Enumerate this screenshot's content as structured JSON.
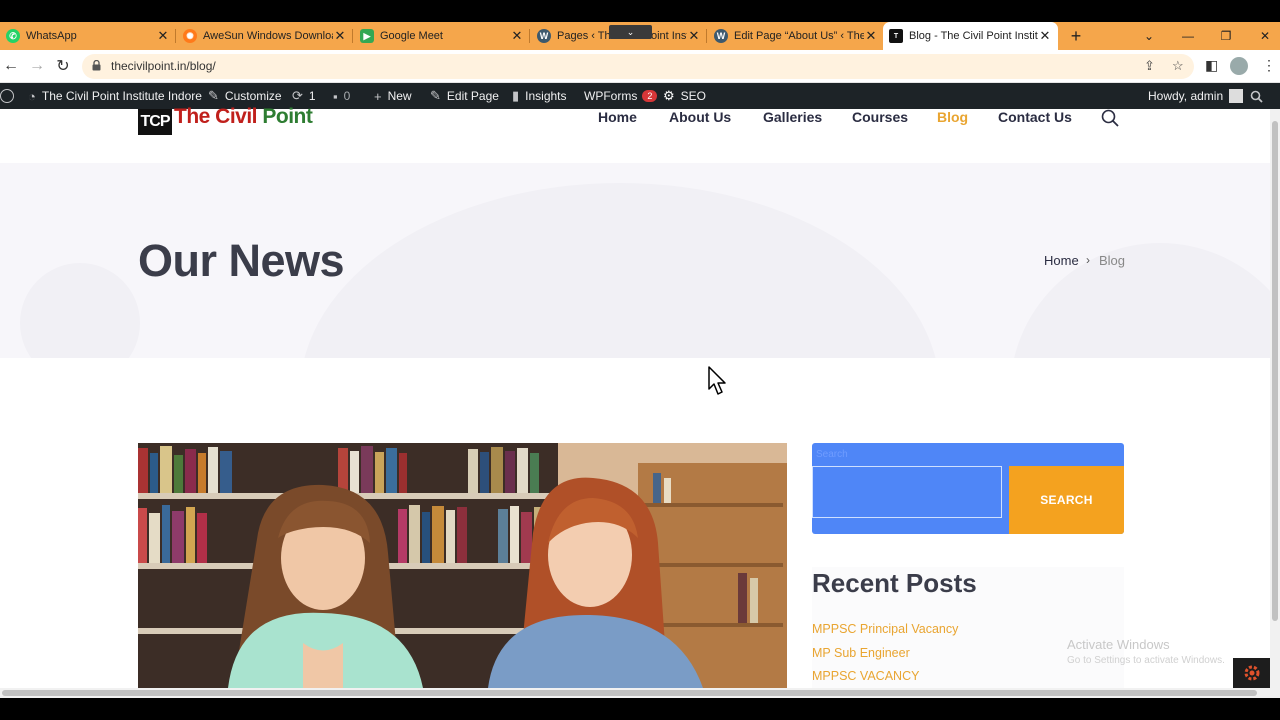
{
  "browser": {
    "tabs": [
      {
        "label": "WhatsApp",
        "icon": "whatsapp-icon"
      },
      {
        "label": "AweSun Windows Downloa",
        "icon": "awesun-icon"
      },
      {
        "label": "Google Meet",
        "icon": "google-meet-icon"
      },
      {
        "label": "Pages ‹ The Civil Point Instit",
        "icon": "wordpress-icon"
      },
      {
        "label": "Edit Page “About Us” ‹ The",
        "icon": "wordpress-icon"
      },
      {
        "label": "Blog - The Civil Point Institu",
        "icon": "tcp-site-icon"
      }
    ],
    "url": "thecivilpoint.in/blog/"
  },
  "admin_bar": {
    "site_name": "The Civil Point Institute Indore",
    "customize": "Customize",
    "updates_count": "1",
    "comments_count": "0",
    "new": "New",
    "edit_page": "Edit Page",
    "insights": "Insights",
    "wpforms": "WPForms",
    "wpforms_badge": "2",
    "seo": "SEO",
    "howdy": "Howdy, admin"
  },
  "site": {
    "logo_mark": "TCP",
    "logo_text_1": "The Civil",
    "logo_text_2": "Point",
    "nav": [
      "Home",
      "About Us",
      "Galleries",
      "Courses",
      "Blog",
      "Contact Us"
    ],
    "active_nav": "Blog",
    "accent_color": "#e9a531"
  },
  "hero": {
    "title": "Our News",
    "breadcrumb_home": "Home",
    "breadcrumb_sep": "›",
    "breadcrumb_current": "Blog"
  },
  "sidebar": {
    "search_label": "Search",
    "search_value": "",
    "search_button": "SEARCH",
    "recent_title": "Recent Posts",
    "recent_posts": [
      "MPPSC Principal Vacancy",
      "MP Sub Engineer",
      "MPPSC VACANCY"
    ]
  },
  "windows_watermark": {
    "line1": "Activate Windows",
    "line2": "Go to Settings to activate Windows."
  }
}
